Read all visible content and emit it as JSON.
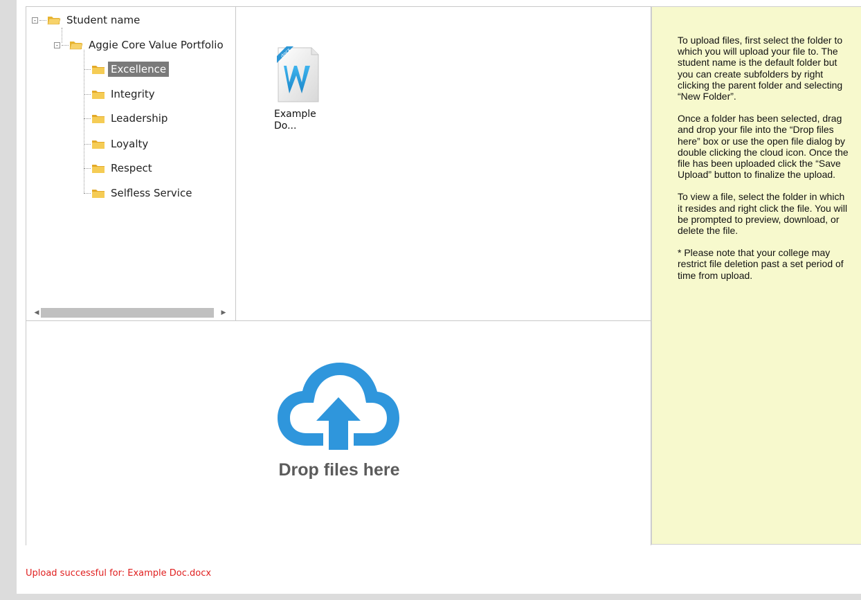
{
  "tree": {
    "root": {
      "label": "Student name",
      "toggle": "-"
    },
    "portfolio": {
      "label": "Aggie Core Value Portfolio",
      "toggle": "-"
    },
    "children": [
      {
        "label": "Excellence",
        "selected": true
      },
      {
        "label": "Integrity",
        "selected": false
      },
      {
        "label": "Leadership",
        "selected": false
      },
      {
        "label": "Loyalty",
        "selected": false
      },
      {
        "label": "Respect",
        "selected": false
      },
      {
        "label": "Selfless Service",
        "selected": false
      }
    ]
  },
  "files": [
    {
      "name_line1": "Example",
      "name_line2": "Do...",
      "type": "docx",
      "icon_letter": "W",
      "badge": "docx"
    }
  ],
  "dropzone": {
    "label": "Drop files here",
    "icon": "cloud-upload-icon",
    "color": "#2f96dc"
  },
  "help": {
    "paragraphs": [
      "To upload files, first select the folder to which you will upload your file to. The student name is the default folder but you can create subfolders by right clicking the parent folder and selecting “New Folder”.",
      "Once a folder has been selected, drag and drop your file into the “Drop files here” box or use the open file dialog by double clicking the cloud icon. Once the file has been uploaded click the “Save Upload” button to finalize the upload.",
      "To view a file, select the folder in which it resides and right click the file. You will be prompted to preview, download, or delete the file.",
      "* Please note that your college may restrict file deletion past a set period of time from upload."
    ]
  },
  "status": {
    "message": "Upload successful for: Example Doc.docx",
    "color": "#e02020"
  },
  "colors": {
    "help_bg": "#f7f9cd",
    "selected_bg": "#7a7a7a",
    "folder": "#f0c040"
  }
}
